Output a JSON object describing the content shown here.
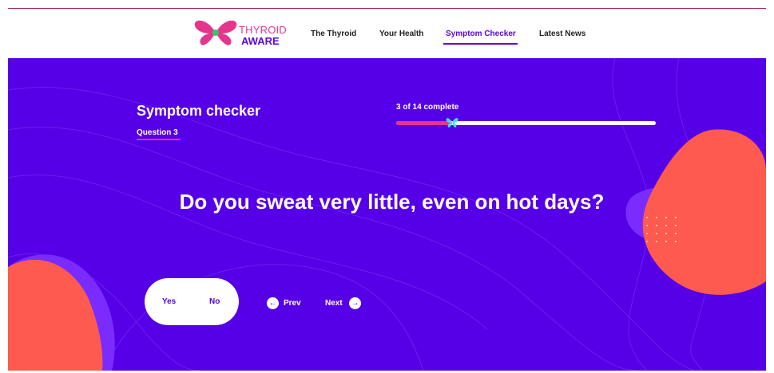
{
  "brand": {
    "name_line1": "THYROID",
    "name_line2": "AWARE"
  },
  "nav": {
    "items": [
      {
        "label": "The Thyroid"
      },
      {
        "label": "Your Health"
      },
      {
        "label": "Symptom Checker",
        "active": true
      },
      {
        "label": "Latest News"
      }
    ]
  },
  "checker": {
    "title": "Symptom checker",
    "question_label": "Question 3",
    "progress_text": "3 of 14 complete",
    "progress": {
      "current": 3,
      "total": 14
    },
    "question": "Do you sweat very little, even on hot days?",
    "answers": {
      "yes": "Yes",
      "no": "No"
    },
    "prev_label": "Prev",
    "next_label": "Next"
  },
  "colors": {
    "hero_bg": "#5500e6",
    "accent_pink": "#e5358c",
    "blob_coral": "#ff5a4f",
    "blob_violet": "#7a2bff",
    "marker_cyan": "#3ee0f0"
  },
  "icons": {
    "logo": "butterfly-icon",
    "prev": "arrow-left-icon",
    "next": "arrow-right-icon",
    "progress_marker": "butterfly-icon"
  }
}
